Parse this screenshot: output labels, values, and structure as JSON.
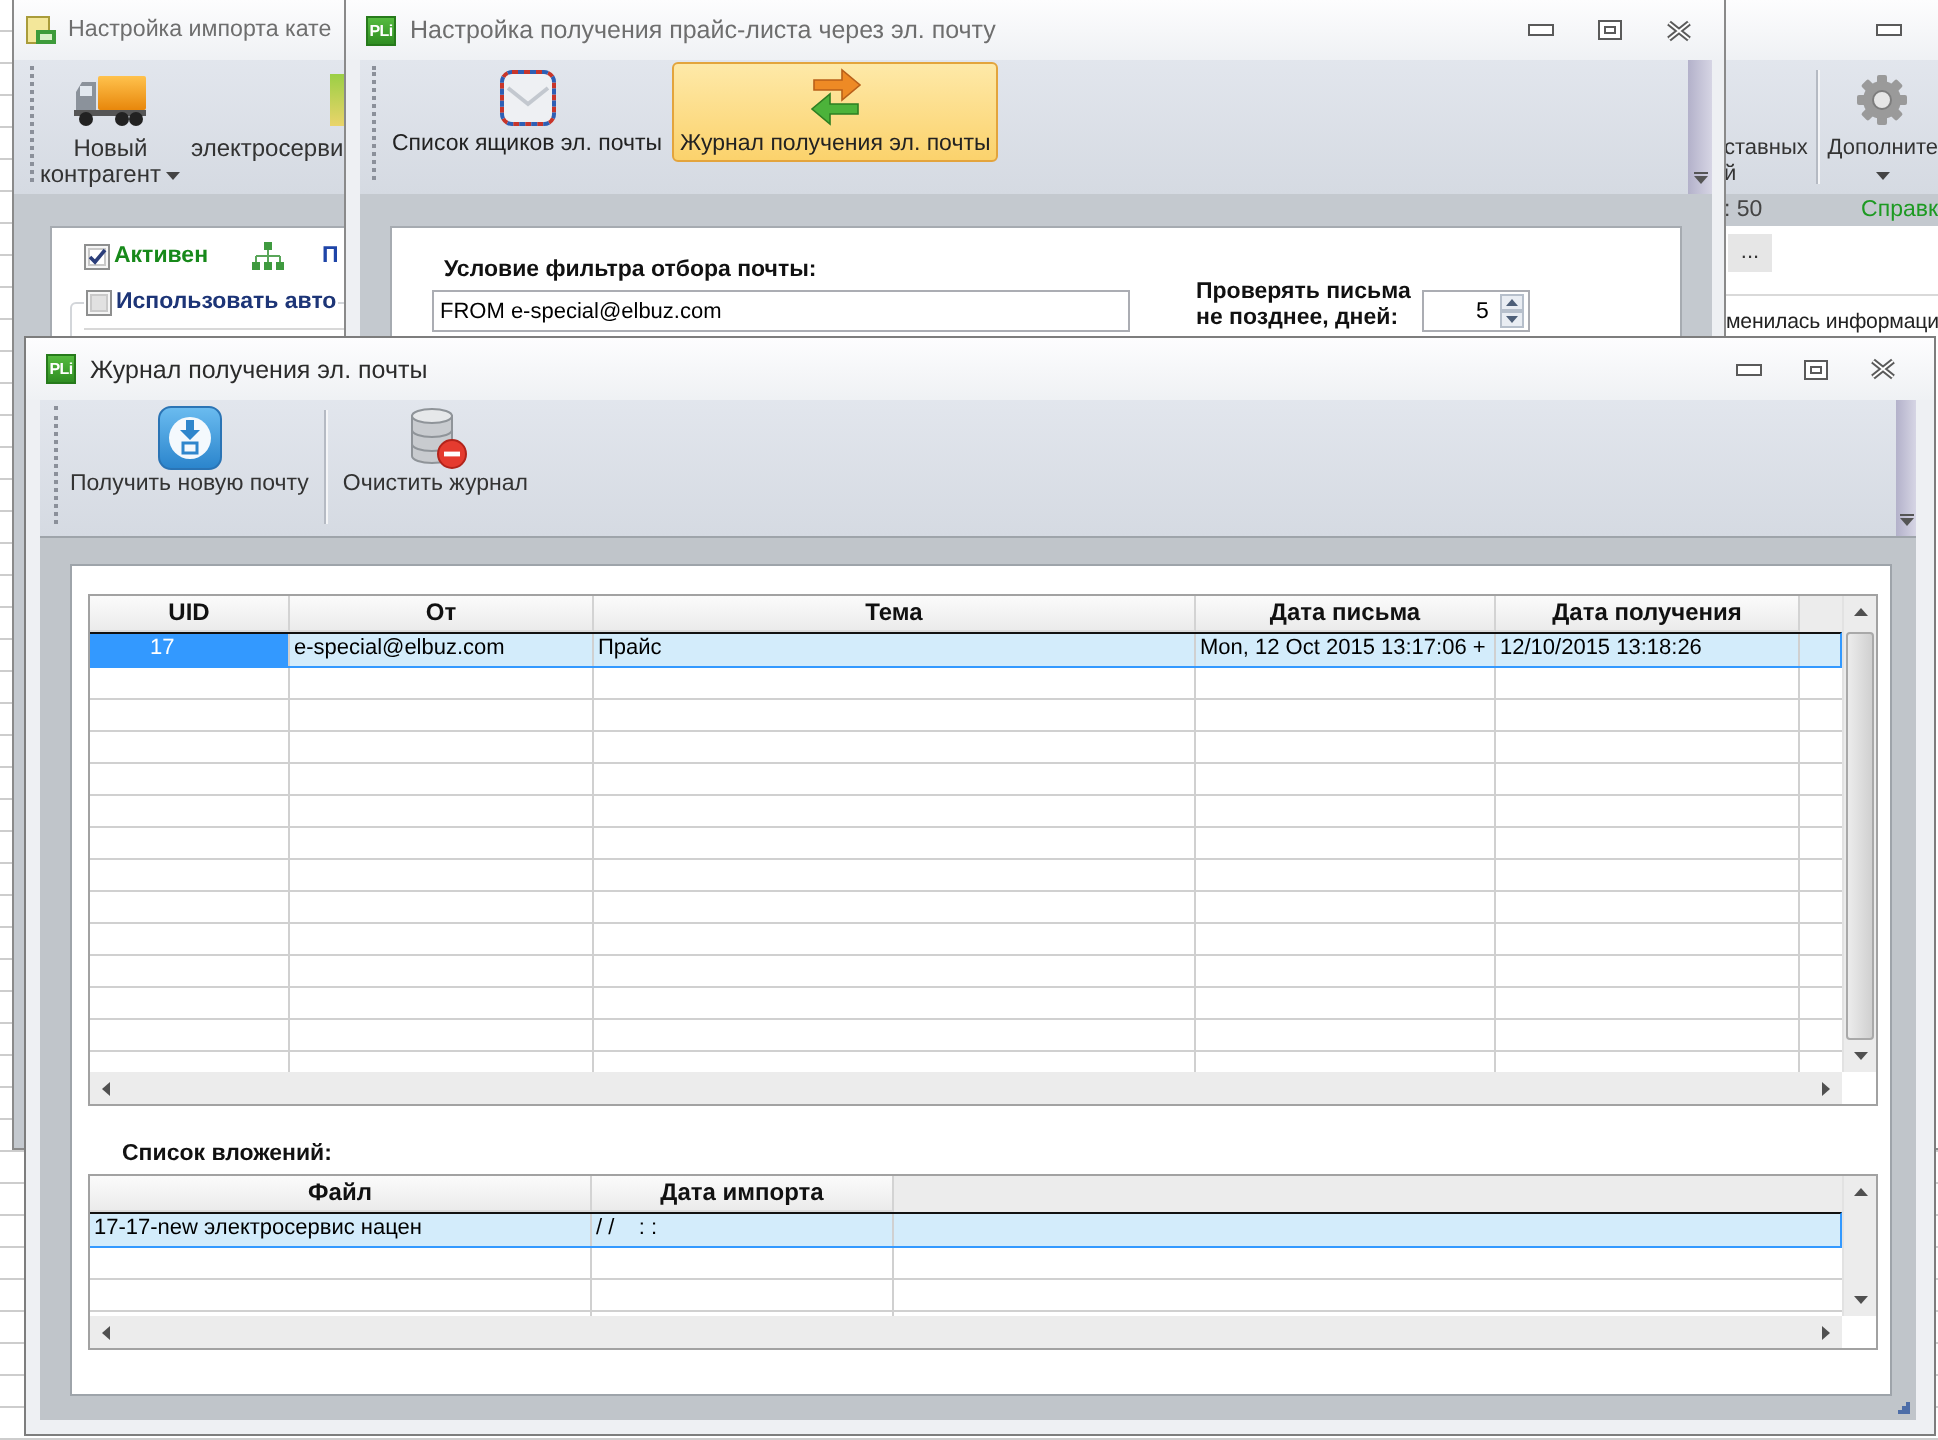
{
  "back_window": {
    "title": "Настройка импорта кате",
    "toolbar_left": [
      {
        "kind": "truck",
        "lines": [
          "Новый",
          "контрагент"
        ],
        "dropdown": true
      },
      {
        "kind": "sheet",
        "lines": [
          "электросерви"
        ],
        "dropdown": false
      }
    ],
    "toolbar_right": [
      {
        "kind": "none",
        "lines": [
          "ставных",
          "й"
        ],
        "dropdown": false
      },
      {
        "kind": "gear",
        "lines": [
          "Дополните"
        ],
        "dropdown": true
      }
    ],
    "options": [
      {
        "kind": "status",
        "label": "Активен",
        "checked": true
      },
      {
        "kind": "setting",
        "label": "Использовать авто",
        "checked": false
      }
    ],
    "link": "П",
    "status": ": 50",
    "help_link": "Справк",
    "browse_button": "...",
    "message": "менилась информаци"
  },
  "mail_settings_window": {
    "title_icon": "PLi",
    "title": "Настройка получения прайс-листа через эл. почту",
    "toolbar": [
      {
        "kind": "mailboxes",
        "label": "Список ящиков эл. почты",
        "selected": false
      },
      {
        "kind": "journal",
        "label": "Журнал получения эл. почты",
        "selected": true
      }
    ],
    "filter": {
      "label": "Условие фильтра отбора почты:",
      "value": "FROM e-special@elbuz.com"
    },
    "max_age": {
      "lines": [
        "Проверять письма",
        "не позднее, дней:"
      ],
      "value": "5"
    }
  },
  "journal_window": {
    "title_icon": "PLi",
    "title": "Журнал получения эл. почты",
    "toolbar": [
      {
        "kind": "receive",
        "label": "Получить новую почту"
      },
      {
        "kind": "clear",
        "label": "Очистить журнал"
      }
    ],
    "messages": {
      "columns": [
        "UID",
        "От",
        "Тема",
        "Дата письма",
        "Дата получения"
      ],
      "rows": [
        {
          "selected": true,
          "focused": true,
          "cells": [
            "17",
            "e-special@elbuz.com",
            "Прайс",
            "Mon, 12 Oct 2015 13:17:06 +",
            "12/10/2015 13:18:26"
          ]
        }
      ]
    },
    "attachments_label": "Список вложений:",
    "attachments": {
      "columns": [
        "Файл",
        "Дата импорта"
      ],
      "rows": [
        {
          "selected": true,
          "focused": false,
          "cells": [
            "17-17-new электросервис нацен",
            "/ /    : :"
          ]
        }
      ]
    }
  }
}
